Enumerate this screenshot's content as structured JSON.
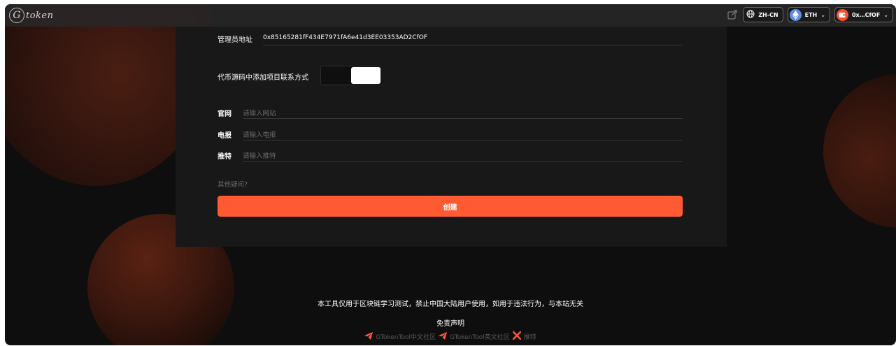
{
  "header": {
    "logo_glyph": "G",
    "logo_text": "token",
    "language": "ZH-CN",
    "network": "ETH",
    "wallet": "0x…CfOF"
  },
  "form": {
    "admin_label": "管理员地址",
    "admin_value": "0x85165281fF434E7971fA6e41d3EE03353AD2CfOF",
    "contact_toggle_label": "代币源码中添加项目联系方式",
    "fields": [
      {
        "label": "官网",
        "placeholder": "请输入网站"
      },
      {
        "label": "电报",
        "placeholder": "请输入电报"
      },
      {
        "label": "推特",
        "placeholder": "请输入推特"
      }
    ],
    "other_question": "其他疑问?",
    "create_label": "创建"
  },
  "footer": {
    "notice": "本工具仅用于区块链学习测试，禁止中国大陆用户使用，如用于违法行为，与本站无关",
    "disclaimer": "免责声明",
    "links": [
      {
        "label": "GTokenTool中文社区",
        "icon": "telegram-icon"
      },
      {
        "label": "GTokenTool英文社区",
        "icon": "telegram-icon"
      },
      {
        "label": "推特",
        "icon": "x-icon"
      }
    ]
  },
  "colors": {
    "accent": "#ff5a32",
    "background": "#0e0e0e",
    "card": "#181818"
  }
}
